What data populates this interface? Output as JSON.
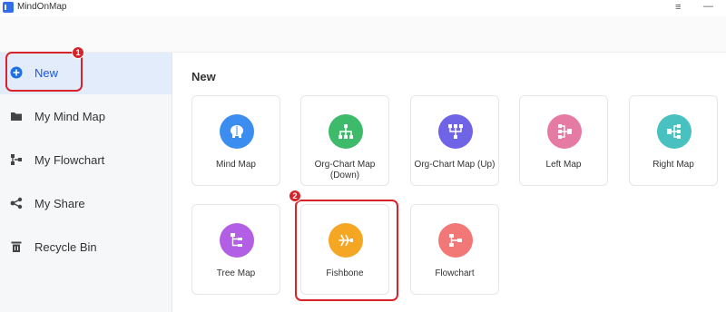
{
  "window": {
    "title": "MindOnMap",
    "menu_glyph": "≡",
    "minimize_glyph": "—"
  },
  "sidebar": {
    "items": [
      {
        "label": "New",
        "icon": "plus-circle-icon",
        "active": true
      },
      {
        "label": "My Mind Map",
        "icon": "folder-icon"
      },
      {
        "label": "My Flowchart",
        "icon": "flowchart-icon"
      },
      {
        "label": "My Share",
        "icon": "share-icon"
      },
      {
        "label": "Recycle Bin",
        "icon": "trash-icon"
      }
    ]
  },
  "main": {
    "title": "New",
    "templates": [
      {
        "label": "Mind Map",
        "icon": "brain-icon",
        "color": "#3c8df0"
      },
      {
        "label": "Org-Chart Map (Down)",
        "icon": "org-chart-down-icon",
        "color": "#3dbb6a"
      },
      {
        "label": "Org-Chart Map (Up)",
        "icon": "org-chart-up-icon",
        "color": "#6f63e6"
      },
      {
        "label": "Left Map",
        "icon": "left-map-icon",
        "color": "#e57aa2"
      },
      {
        "label": "Right Map",
        "icon": "right-map-icon",
        "color": "#49c1c1"
      },
      {
        "label": "Tree Map",
        "icon": "tree-map-icon",
        "color": "#b35fe5"
      },
      {
        "label": "Fishbone",
        "icon": "fishbone-icon",
        "color": "#f5a623"
      },
      {
        "label": "Flowchart",
        "icon": "flowchart-icon",
        "color": "#f27878"
      }
    ]
  },
  "annotations": {
    "step1": "1",
    "step2": "2",
    "highlight_color": "#d9232b"
  }
}
